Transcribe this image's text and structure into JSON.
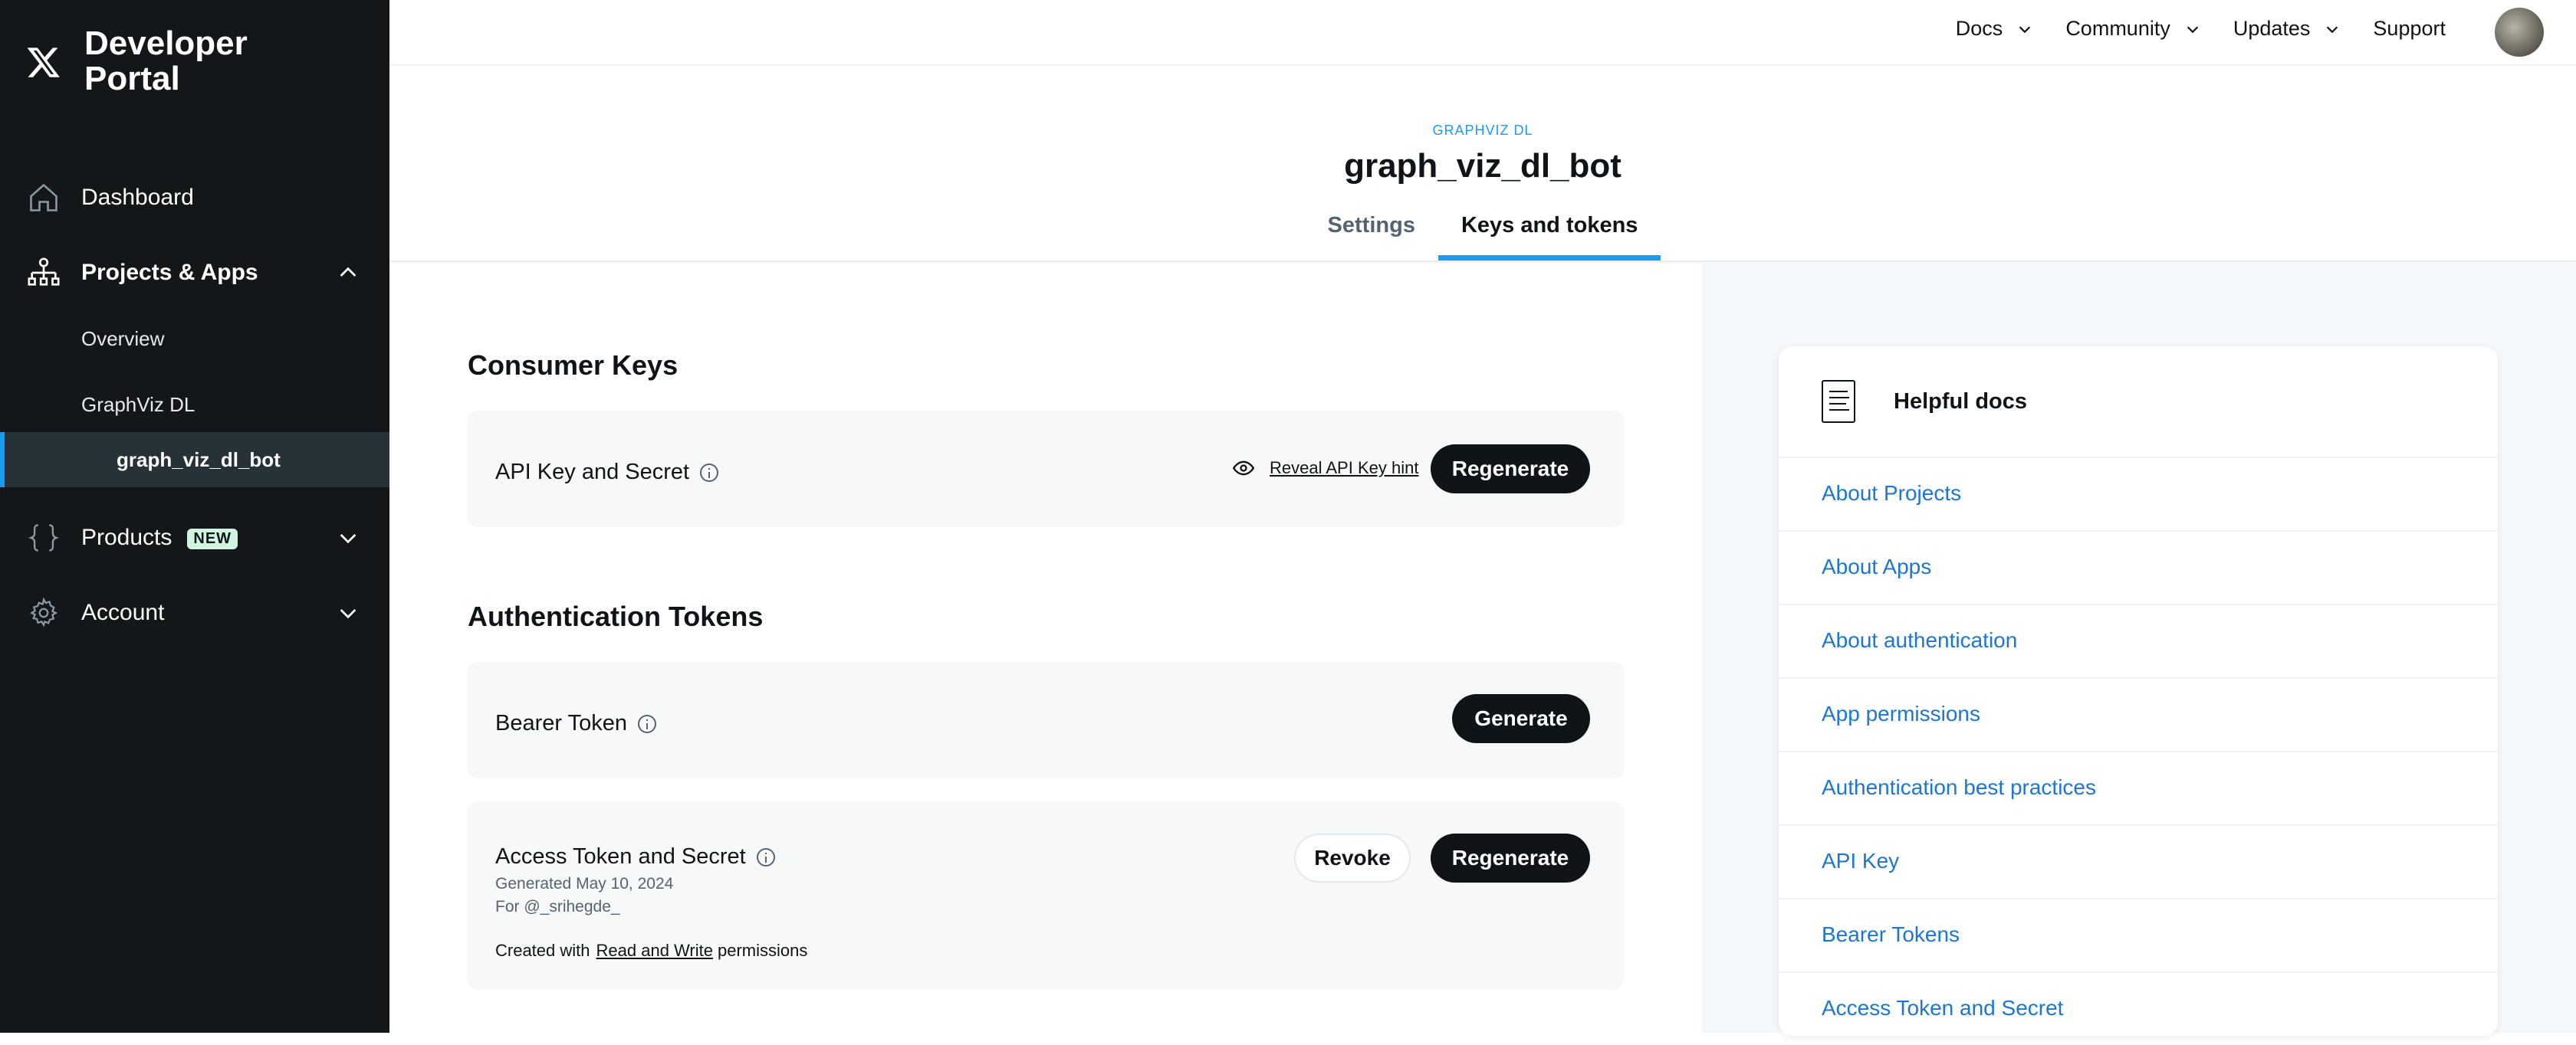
{
  "sidebar": {
    "brand": "Developer Portal",
    "items": [
      {
        "label": "Dashboard",
        "icon": "home-icon"
      },
      {
        "label": "Projects & Apps",
        "icon": "projects-icon"
      },
      {
        "label": "Products",
        "icon": "braces-icon",
        "badge": "NEW"
      },
      {
        "label": "Account",
        "icon": "gear-icon"
      }
    ],
    "sub_items": [
      "Overview",
      "GraphViz DL",
      "graph_viz_dl_bot"
    ]
  },
  "topnav": {
    "links": [
      "Docs",
      "Community",
      "Updates",
      "Support"
    ]
  },
  "header": {
    "project_label": "GRAPHVIZ DL",
    "app_name": "graph_viz_dl_bot",
    "tabs": [
      "Settings",
      "Keys and tokens"
    ],
    "active_tab": "Keys and tokens"
  },
  "consumer_keys": {
    "title": "Consumer Keys",
    "api_key_label": "API Key and Secret",
    "reveal_label": "Reveal API Key hint",
    "regenerate_label": "Regenerate"
  },
  "auth_tokens": {
    "title": "Authentication Tokens",
    "bearer_label": "Bearer Token",
    "generate_label": "Generate",
    "access_label": "Access Token and Secret",
    "generated": "Generated May 10, 2024",
    "for_user": "For @_srihegde_",
    "created_prefix": "Created with",
    "created_link": "Read and Write",
    "created_suffix": "permissions",
    "revoke_label": "Revoke",
    "regenerate_label": "Regenerate"
  },
  "helpful_docs": {
    "title": "Helpful docs",
    "links": [
      "About Projects",
      "About Apps",
      "About authentication",
      "App permissions",
      "Authentication best practices",
      "API Key",
      "Bearer Tokens",
      "Access Token and Secret"
    ]
  },
  "colors": {
    "accent": "#1d9bf0",
    "sidebar_bg": "#14171a",
    "link": "#1d76d2"
  }
}
